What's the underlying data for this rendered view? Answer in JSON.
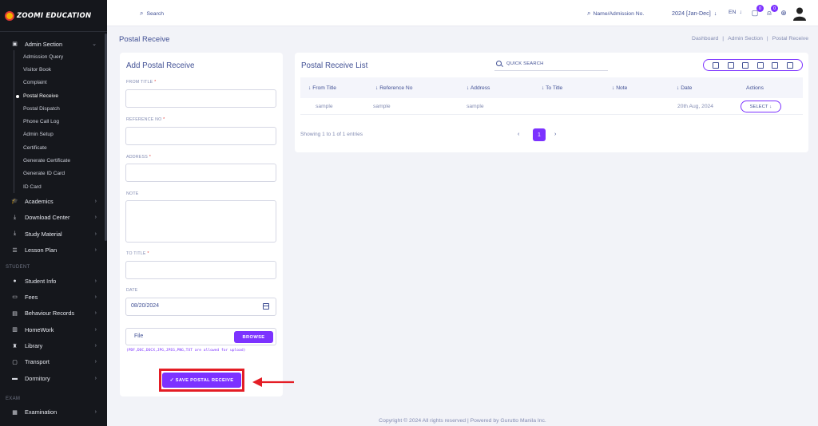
{
  "brand": {
    "name": "ZOOMI EDUCATION"
  },
  "sidebar": {
    "sections": {
      "student": "STUDENT",
      "exam": "EXAM"
    },
    "admin": {
      "label": "Admin Section",
      "icon": "admin-icon"
    },
    "submenu": [
      "Admission Query",
      "Visitor Book",
      "Complaint",
      "Postal Receive",
      "Postal Dispatch",
      "Phone Call Log",
      "Admin Setup",
      "Certificate",
      "Generate Certificate",
      "Generate ID Card",
      "ID Card"
    ],
    "active_submenu": "Postal Receive",
    "items": [
      {
        "label": "Academics",
        "icon": "graduation-cap-icon"
      },
      {
        "label": "Download Center",
        "icon": "download-icon"
      },
      {
        "label": "Study Material",
        "icon": "download-icon"
      },
      {
        "label": "Lesson Plan",
        "icon": "list-icon"
      }
    ],
    "student_items": [
      {
        "label": "Student Info",
        "icon": "user-icon"
      },
      {
        "label": "Fees",
        "icon": "money-icon"
      },
      {
        "label": "Behaviour Records",
        "icon": "records-icon"
      },
      {
        "label": "HomeWork",
        "icon": "book-open-icon"
      },
      {
        "label": "Library",
        "icon": "library-icon"
      },
      {
        "label": "Transport",
        "icon": "bus-icon"
      },
      {
        "label": "Dormitory",
        "icon": "bed-icon"
      }
    ],
    "exam_items": [
      {
        "label": "Examination",
        "icon": "exam-icon"
      }
    ]
  },
  "topbar": {
    "search_placeholder": "Search",
    "name_search_placeholder": "Name/Admission No.",
    "session": "2024 [Jan-Dec]",
    "lang": "EN",
    "chat_badge": "0",
    "bell_badge": "0"
  },
  "page": {
    "title": "Postal Receive",
    "breadcrumb": [
      "Dashboard",
      "Admin Section",
      "Postal Receive"
    ]
  },
  "form": {
    "title": "Add Postal Receive",
    "from_title": "FROM TITLE",
    "reference_no": "REFERENCE NO",
    "address": "ADDRESS",
    "note": "NOTE",
    "to_title": "TO TITLE",
    "date": "DATE",
    "date_value": "08/20/2024",
    "required_mark": "*",
    "file_placeholder": "File",
    "browse_label": "BROWSE",
    "file_hint": "(PDF,DOC,DOCX,JPG,JPEG,PNG,TXT are allowed for upload)",
    "save_label": "✓ SAVE POSTAL RECEIVE"
  },
  "list": {
    "title": "Postal Receive List",
    "quick_search": "QUICK SEARCH",
    "columns": [
      "From Title",
      "Reference No",
      "Address",
      "To Title",
      "Note",
      "Date",
      "Actions"
    ],
    "rows": [
      {
        "from_title": "sample",
        "reference_no": "sample",
        "address": "sample",
        "to_title": "",
        "note": "",
        "date": "20th Aug, 2024",
        "action": "SELECT"
      }
    ],
    "showing": "Showing 1 to 1 of 1 entries",
    "page": "1"
  },
  "footer": "Copyright © 2024 All rights reserved | Powered by Gurutto Manila Inc.",
  "colors": {
    "accent": "#7c32ff",
    "highlight": "#e41d25",
    "text": "#415094"
  }
}
